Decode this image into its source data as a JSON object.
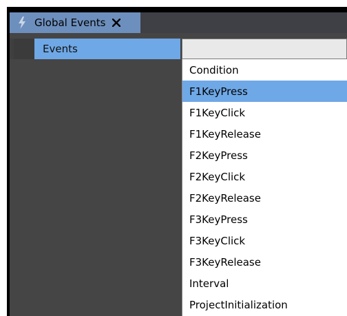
{
  "tab": {
    "title": "Global Events",
    "icon": "lightning-icon",
    "close_icon": "close-icon"
  },
  "grid": {
    "column_header": "Events"
  },
  "dropdown": {
    "selected_value": "",
    "selected_index": 1,
    "items": [
      "Condition",
      "F1KeyPress",
      "F1KeyClick",
      "F1KeyRelease",
      "F2KeyPress",
      "F2KeyClick",
      "F2KeyRelease",
      "F3KeyPress",
      "F3KeyClick",
      "F3KeyRelease",
      "Interval",
      "ProjectInitialization"
    ]
  },
  "colors": {
    "tab_active": "#6d8fbd",
    "highlight": "#6fa8e6",
    "pane_background": "#454545",
    "window_background": "#000000"
  }
}
